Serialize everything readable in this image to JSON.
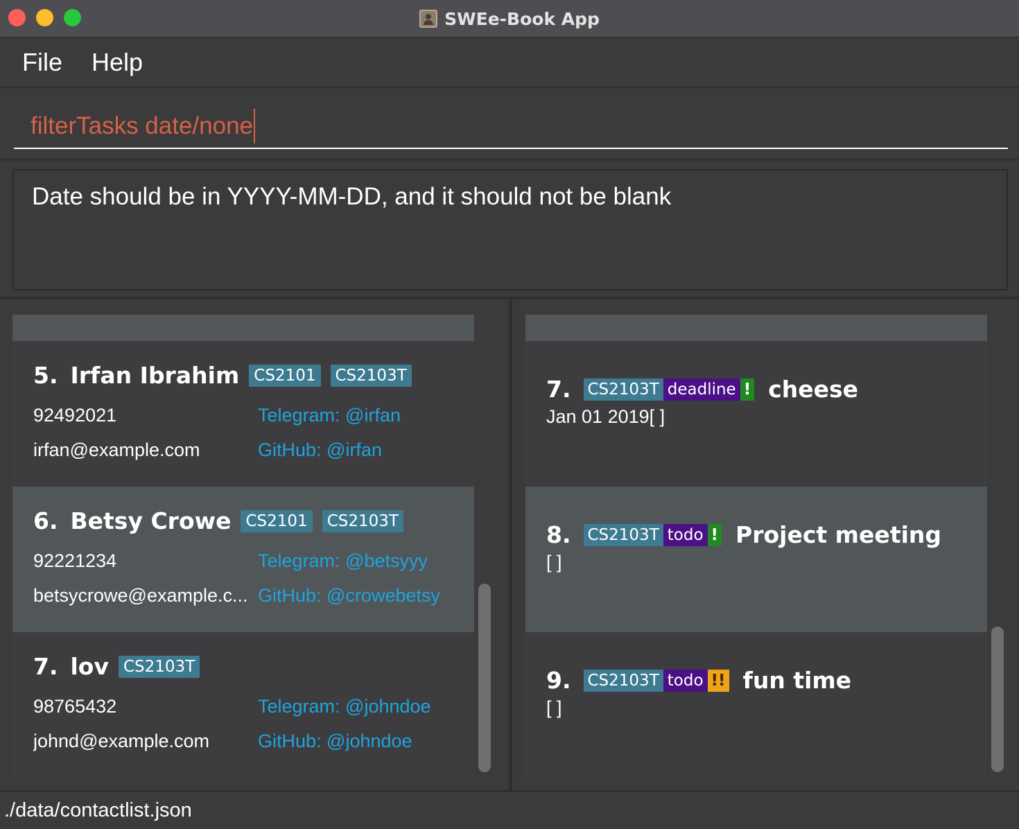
{
  "window": {
    "title": "SWEe-Book App"
  },
  "menu": {
    "items": [
      "File",
      "Help"
    ]
  },
  "command": {
    "value": "filterTasks date/none"
  },
  "result": {
    "message": "Date should be in YYYY-MM-DD, and it should not be blank"
  },
  "persons": [
    {
      "index": "5.",
      "name": "Irfan Ibrahim",
      "tags": [
        "CS2101",
        "CS2103T"
      ],
      "phone": "92492021",
      "email": "irfan@example.com",
      "telegram": "Telegram: @irfan",
      "github": "GitHub: @irfan"
    },
    {
      "index": "6.",
      "name": "Betsy Crowe",
      "tags": [
        "CS2101",
        "CS2103T"
      ],
      "phone": "92221234",
      "email": "betsycrowe@example.c...",
      "telegram": "Telegram: @betsyyy",
      "github": "GitHub: @crowebetsy"
    },
    {
      "index": "7.",
      "name": "lov",
      "tags": [
        "CS2103T"
      ],
      "phone": "98765432",
      "email": "johnd@example.com",
      "telegram": "Telegram: @johndoe",
      "github": "GitHub: @johndoe"
    }
  ],
  "tasks": [
    {
      "index": "7.",
      "module": "CS2103T",
      "type": "deadline",
      "priority": "!",
      "title": "cheese",
      "date": "Jan 01 2019[ ]"
    },
    {
      "index": "8.",
      "module": "CS2103T",
      "type": "todo",
      "priority": "!",
      "title": "Project meeting",
      "date": "[ ]"
    },
    {
      "index": "9.",
      "module": "CS2103T",
      "type": "todo",
      "priority": "!!",
      "title": "fun time",
      "date": "[ ]"
    }
  ],
  "status": {
    "path": "./data/contactlist.json"
  },
  "colors": {
    "tag": "#3e7b91",
    "type": "#4b0f86",
    "priority_low": "#1f8a22",
    "priority_medium": "#f0a31a",
    "link": "#1fa3dd",
    "command_text": "#d8604a"
  }
}
